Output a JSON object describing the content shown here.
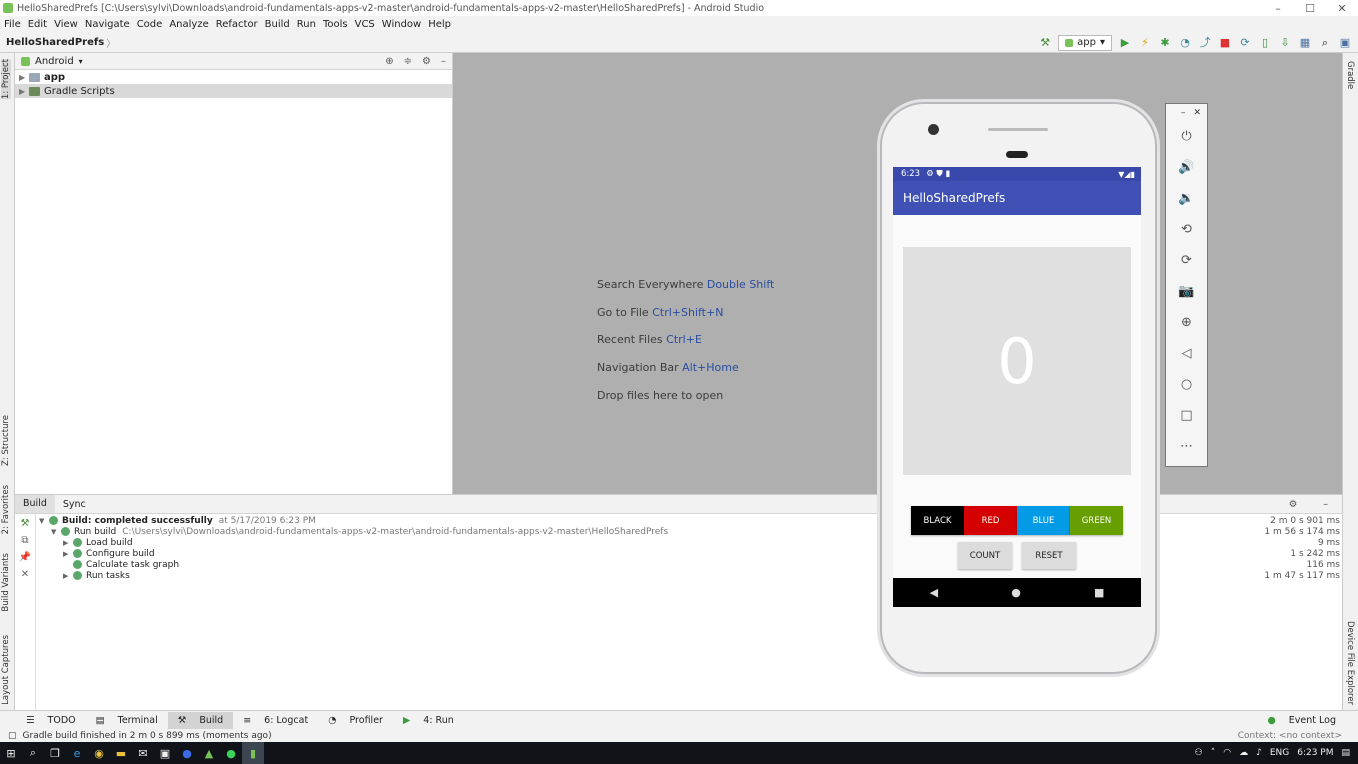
{
  "window": {
    "title": "HelloSharedPrefs [C:\\Users\\sylvi\\Downloads\\android-fundamentals-apps-v2-master\\android-fundamentals-apps-v2-master\\HelloSharedPrefs] - Android Studio",
    "minimize": "–",
    "maximize": "☐",
    "close": "✕"
  },
  "menu": [
    "File",
    "Edit",
    "View",
    "Navigate",
    "Code",
    "Analyze",
    "Refactor",
    "Build",
    "Run",
    "Tools",
    "VCS",
    "Window",
    "Help"
  ],
  "toolbar": {
    "breadcrumb": "HelloSharedPrefs",
    "breadcrumb_sep": "〉",
    "run_config": "app",
    "dropdown": "▾",
    "icons": [
      "hammer-icon",
      "run-icon",
      "apply-changes-icon",
      "debug-icon",
      "profile-icon",
      "attach-debugger-icon",
      "stop-icon",
      "sync-gradle-icon",
      "avd-manager-icon",
      "sdk-manager-icon",
      "project-structure-icon",
      "search-icon",
      "layout-inspector-icon"
    ]
  },
  "left_strip": {
    "project": "1: Project",
    "structure": "Z: Structure",
    "favorites": "2: Favorites",
    "build_variants": "Build Variants",
    "layout_captures": "Layout Captures"
  },
  "right_strip": {
    "gradle": "Gradle",
    "device_file_explorer": "Device File Explorer"
  },
  "project_panel": {
    "view_mode": "Android",
    "tree": [
      {
        "label": "app",
        "bold": true
      },
      {
        "label": "Gradle Scripts",
        "bold": false
      }
    ]
  },
  "editor_hints": [
    {
      "text": "Search Everywhere",
      "key": "Double Shift"
    },
    {
      "text": "Go to File",
      "key": "Ctrl+Shift+N"
    },
    {
      "text": "Recent Files",
      "key": "Ctrl+E"
    },
    {
      "text": "Navigation Bar",
      "key": "Alt+Home"
    },
    {
      "text": "Drop files here to open",
      "key": ""
    }
  ],
  "build_panel": {
    "tabs": [
      "Build",
      "Sync"
    ],
    "rows": [
      {
        "label": "Build: completed successfully",
        "detail": "at 5/17/2019 6:23 PM",
        "time": "2 m 0 s 901 ms"
      },
      {
        "label": "Run build",
        "detail": "C:\\Users\\sylvi\\Downloads\\android-fundamentals-apps-v2-master\\android-fundamentals-apps-v2-master\\HelloSharedPrefs",
        "time": "1 m 56 s 174 ms"
      },
      {
        "label": "Load build",
        "detail": "",
        "time": "9 ms"
      },
      {
        "label": "Configure build",
        "detail": "",
        "time": "1 s 242 ms"
      },
      {
        "label": "Calculate task graph",
        "detail": "",
        "time": "116 ms"
      },
      {
        "label": "Run tasks",
        "detail": "",
        "time": "1 m 47 s 117 ms"
      }
    ]
  },
  "bottom_tabs": [
    "TODO",
    "Terminal",
    "Build",
    "6: Logcat",
    "Profiler",
    "4: Run"
  ],
  "event_log": "Event Log",
  "status": {
    "message": "Gradle build finished in 2 m 0 s 899 ms (moments ago)",
    "context": "Context: <no context>"
  },
  "taskbar": {
    "lang": "ENG",
    "time": "6:23 PM"
  },
  "emulator": {
    "status_time": "6:23",
    "app_title": "HelloSharedPrefs",
    "count": "0",
    "color_buttons": [
      {
        "label": "BLACK",
        "color": "#000000"
      },
      {
        "label": "RED",
        "color": "#d50000"
      },
      {
        "label": "BLUE",
        "color": "#039be5"
      },
      {
        "label": "GREEN",
        "color": "#689f00"
      }
    ],
    "count_button": "COUNT",
    "reset_button": "RESET",
    "nav": {
      "back": "◀",
      "home": "●",
      "recents": "■"
    }
  },
  "colors": {
    "accent": "#3f51b5",
    "status_bar": "#3949ab",
    "link": "#2a4ea0",
    "success": "#59a869"
  }
}
